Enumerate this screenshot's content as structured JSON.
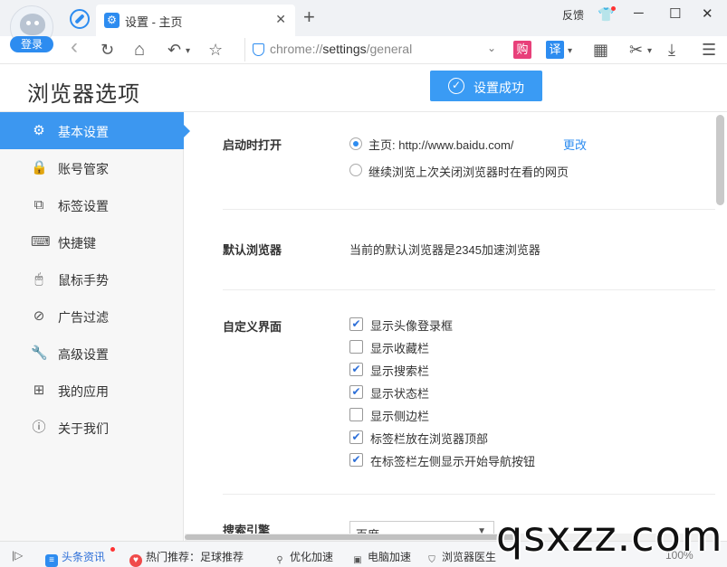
{
  "titlebar": {
    "login_label": "登录",
    "tab_title": "设置 - 主页",
    "tab_close": "✕",
    "new_tab": "+",
    "feedback": "反馈",
    "minimize": "─",
    "maximize": "☐",
    "close": "✕"
  },
  "toolbar": {
    "back": "‹",
    "refresh": "↻",
    "home": "⌂",
    "undo": "↶",
    "undo_dd": "▾",
    "favorite": "☆",
    "url_scheme": "chrome://",
    "url_host": "settings",
    "url_path": "/general",
    "addr_dropdown": "⌄",
    "shop_badge": "购",
    "translate_badge": "译",
    "translate_dd": "▾",
    "apps": "▦",
    "scissors": "✂",
    "scissors_dd": "▾",
    "download": "⤓",
    "menu": "☰",
    "shop_color": "#e8407a",
    "translate_color": "#2d8cf0"
  },
  "page": {
    "title": "浏览器选项",
    "toast": "设置成功",
    "toast_icon": "✓"
  },
  "sidebar": {
    "items": [
      {
        "label": "基本设置",
        "icon": "⚙",
        "active": true
      },
      {
        "label": "账号管家",
        "icon": "🔒"
      },
      {
        "label": "标签设置",
        "icon": "⧉"
      },
      {
        "label": "快捷键",
        "icon": "⌨"
      },
      {
        "label": "鼠标手势",
        "icon": "🖱"
      },
      {
        "label": "广告过滤",
        "icon": "⊘"
      },
      {
        "label": "高级设置",
        "icon": "🔧"
      },
      {
        "label": "我的应用",
        "icon": "⊞"
      },
      {
        "label": "关于我们",
        "icon": "ⓘ"
      }
    ]
  },
  "content": {
    "startup": {
      "title": "启动时打开",
      "option_home": "主页: http://www.baidu.com/",
      "change_link": "更改",
      "option_continue": "继续浏览上次关闭浏览器时在看的网页"
    },
    "default_browser": {
      "title": "默认浏览器",
      "text": "当前的默认浏览器是2345加速浏览器"
    },
    "customize": {
      "title": "自定义界面",
      "options": [
        {
          "label": "显示头像登录框",
          "checked": true
        },
        {
          "label": "显示收藏栏",
          "checked": false
        },
        {
          "label": "显示搜索栏",
          "checked": true
        },
        {
          "label": "显示状态栏",
          "checked": true
        },
        {
          "label": "显示侧边栏",
          "checked": false
        },
        {
          "label": "标签栏放在浏览器顶部",
          "checked": true
        },
        {
          "label": "在标签栏左侧显示开始导航按钮",
          "checked": true
        }
      ]
    },
    "search": {
      "title": "搜索引擎",
      "selected": "百度",
      "dd": "▼"
    }
  },
  "statusbar": {
    "toggle": "|▷",
    "news": "头条资讯",
    "hot": "热门推荐：足球推荐",
    "optimize": "优化加速",
    "pc_boost": "电脑加速",
    "doctor": "浏览器医生",
    "zoom": "100%"
  },
  "watermark": "qsxzz.com"
}
